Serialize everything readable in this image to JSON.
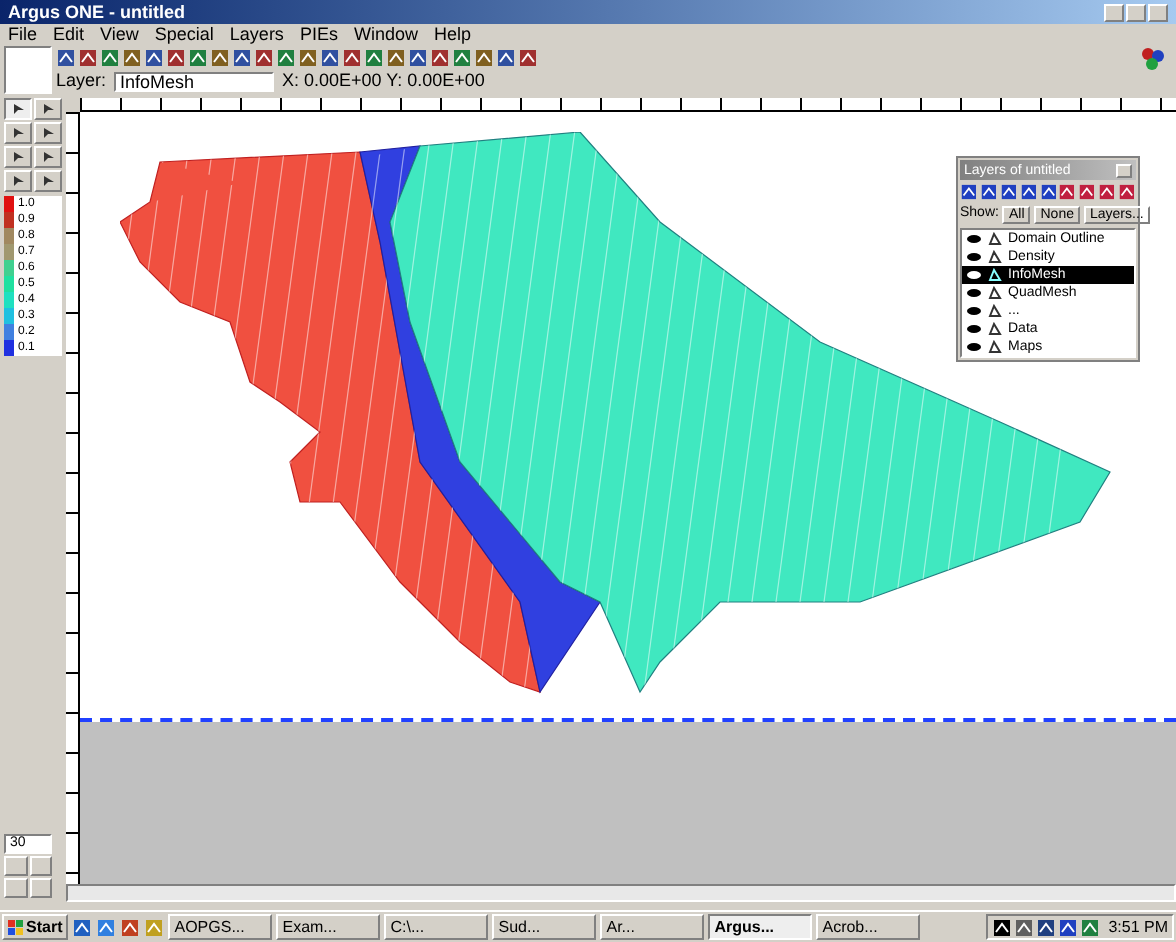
{
  "window": {
    "title": "Argus ONE - untitled"
  },
  "menu": [
    "File",
    "Edit",
    "View",
    "Special",
    "Layers",
    "PIEs",
    "Window",
    "Help"
  ],
  "layer_bar": {
    "label": "Layer:",
    "value": "InfoMesh",
    "coords": "X: 0.00E+00  Y: 0.00E+00"
  },
  "legend": [
    {
      "label": "1.0",
      "color": "#e01010"
    },
    {
      "label": "0.9",
      "color": "#c03020"
    },
    {
      "label": "0.8",
      "color": "#a08860"
    },
    {
      "label": "0.7",
      "color": "#a09870"
    },
    {
      "label": "0.6",
      "color": "#40d090"
    },
    {
      "label": "0.5",
      "color": "#20e0a0"
    },
    {
      "label": "0.4",
      "color": "#20e0c0"
    },
    {
      "label": "0.3",
      "color": "#20c0e0"
    },
    {
      "label": "0.2",
      "color": "#4080e0"
    },
    {
      "label": "0.1",
      "color": "#2030e0"
    }
  ],
  "zoom_field": {
    "value": "30"
  },
  "layers_window": {
    "title": "Layers of untitled",
    "filter_label": "Show:",
    "buttons": [
      "All",
      "None",
      "Layers..."
    ],
    "layers": [
      {
        "name": "Domain Outline",
        "visible": true,
        "selected": false
      },
      {
        "name": "Density",
        "visible": true,
        "selected": false
      },
      {
        "name": "InfoMesh",
        "visible": true,
        "selected": true
      },
      {
        "name": "QuadMesh",
        "visible": true,
        "selected": false
      },
      {
        "name": "...",
        "visible": true,
        "selected": false
      },
      {
        "name": "Data",
        "visible": true,
        "selected": false
      },
      {
        "name": "Maps",
        "visible": true,
        "selected": false
      }
    ]
  },
  "taskbar": {
    "start": "Start",
    "tasks": [
      {
        "label": "AOPGS...",
        "selected": false
      },
      {
        "label": "Exam...",
        "selected": false
      },
      {
        "label": "C:\\...",
        "selected": false
      },
      {
        "label": "Sud...",
        "selected": false
      },
      {
        "label": "Ar...",
        "selected": false
      },
      {
        "label": "Argus...",
        "selected": true
      },
      {
        "label": "Acrob...",
        "selected": false
      }
    ],
    "clock": "3:51 PM"
  }
}
